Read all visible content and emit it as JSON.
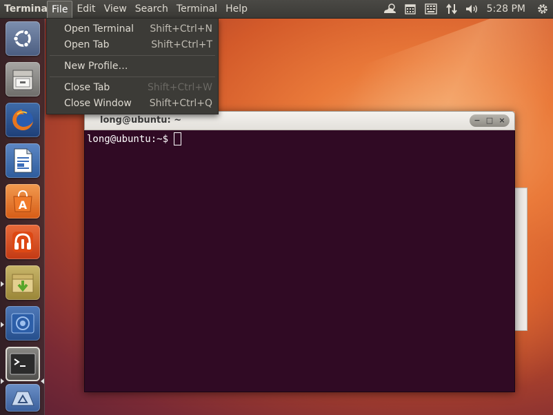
{
  "top_panel": {
    "app_title": "Terminal",
    "menus": [
      "File",
      "Edit",
      "View",
      "Search",
      "Terminal",
      "Help"
    ],
    "clock": "5:28 PM"
  },
  "file_menu": {
    "items": [
      {
        "label": "Open Terminal",
        "accel": "Shift+Ctrl+N",
        "enabled": true
      },
      {
        "label": "Open Tab",
        "accel": "Shift+Ctrl+T",
        "enabled": true
      },
      {
        "label": "New Profile…",
        "accel": "",
        "enabled": true
      },
      {
        "label": "Close Tab",
        "accel": "Shift+Ctrl+W",
        "enabled": true
      },
      {
        "label": "Close Window",
        "accel": "Shift+Ctrl+Q",
        "enabled": true
      }
    ]
  },
  "terminal_window": {
    "title": "long@ubuntu: ~",
    "prompt": "long@ubuntu:~$",
    "controls": [
      "−",
      "□",
      "×"
    ]
  },
  "launcher": {
    "items": [
      "ubuntu-logo-icon",
      "file-cabinet-icon",
      "firefox-icon",
      "writer-document-icon",
      "software-center-icon",
      "ubuntu-one-icon",
      "archive-download-icon",
      "workspace-switcher-icon",
      "terminal-icon",
      "trash-icon"
    ]
  },
  "colors": {
    "terminal_bg": "#300a24",
    "panel_bg": "#3c3b37",
    "ubuntu_orange": "#dd4814"
  }
}
